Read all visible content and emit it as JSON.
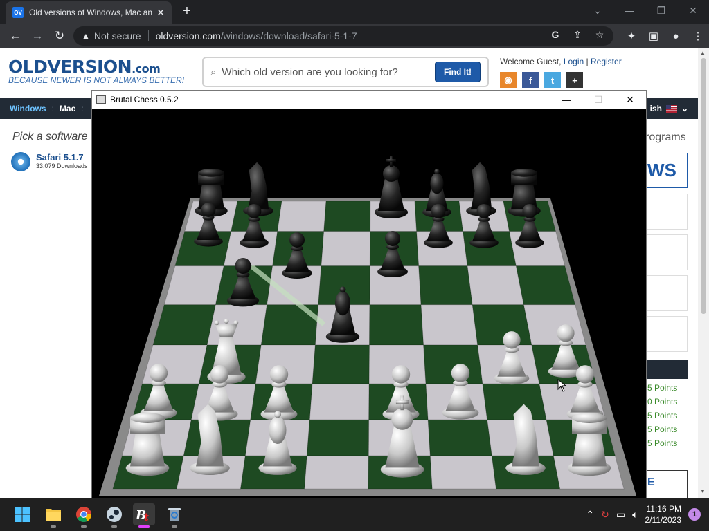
{
  "browser": {
    "tab_title": "Old versions of Windows, Mac an",
    "tab_favicon": "OV",
    "address_warning": "Not secure",
    "address_host": "oldversion.com",
    "address_path": "/windows/download/safari-5-1-7"
  },
  "site": {
    "logo_main": "OLDVERSION",
    "logo_suffix": ".com",
    "logo_tagline": "BECAUSE NEWER IS NOT ALWAYS BETTER!",
    "search_placeholder": "Which old version are you looking for?",
    "find_button": "Find It!",
    "welcome_text": "Welcome Guest,",
    "login_link": "Login",
    "register_link": "Register",
    "nav_windows": "Windows",
    "nav_mac": "Mac",
    "nav_language": "ish",
    "pick_text": "Pick a software",
    "software_name": "Safari 5.1.7",
    "software_downloads": "33,079 Downloads",
    "programs_text": "rograms",
    "news_text": "WS",
    "points": [
      "5 Points",
      "0 Points",
      "5 Points",
      "5 Points",
      "5 Points"
    ],
    "e_box_text": "E"
  },
  "game_window": {
    "title": "Brutal Chess 0.5.2"
  },
  "taskbar": {
    "time": "11:16 PM",
    "date": "2/11/2023",
    "notification_count": "1"
  },
  "colors": {
    "accent": "#1e5aa8",
    "board_dark": "#1e4a22",
    "board_light": "#c9c6cc",
    "board_frame": "#8a8a8a"
  }
}
